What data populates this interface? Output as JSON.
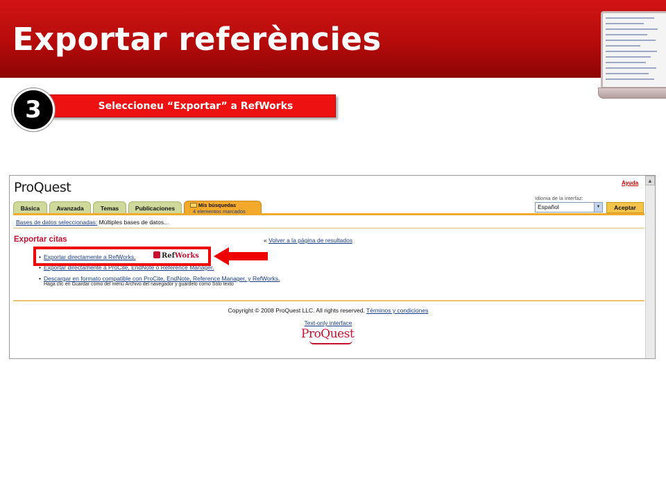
{
  "slide": {
    "title": "Exportar referències",
    "step_number": "3",
    "step_text": "Seleccioneu “Exportar” a RefWorks"
  },
  "colors": {
    "header_red": "#c00000",
    "step_bar": "#ee1111",
    "highlight": "#ee0000",
    "link": "#1a3d8c",
    "heading_red": "#c8102e",
    "tab_green": "#cfd99a",
    "tab_orange": "#f3a92c"
  },
  "proquest": {
    "logo": "ProQuest",
    "help": "Ayuda",
    "tabs": [
      "Básica",
      "Avanzada",
      "Temas",
      "Publicaciones"
    ],
    "active_tab_line1": "Mis búsquedas",
    "active_tab_line2": "4 elementos marcados",
    "language_label": "Idioma de la interfaz:",
    "language_value": "Español",
    "accept": "Aceptar",
    "db_link": "Bases de datos seleccionadas:",
    "db_text": "Múltiples bases de datos...",
    "export_heading": "Exportar citas",
    "back_prefix": "«",
    "back_link": "Volver a la página de resultados",
    "options": [
      "Exportar directamente a RefWorks.",
      "Exportar directamente a ProCite, EndNote o Reference Manager.",
      "Descargar en formato compatible con ProCite, EndNote, Reference Manager, y RefWorks."
    ],
    "option3_note": "Haga clic en Guardar como del menú Archivo del navegador y guárdelo como Sólo texto",
    "refworks_ref": "Ref",
    "refworks_works": "Works",
    "copyright": "Copyright © 2008 ProQuest LLC. All rights reserved.",
    "terms": "Términos y condiciones",
    "text_only": "Text-only interface",
    "footer_logo": "ProQuest"
  }
}
